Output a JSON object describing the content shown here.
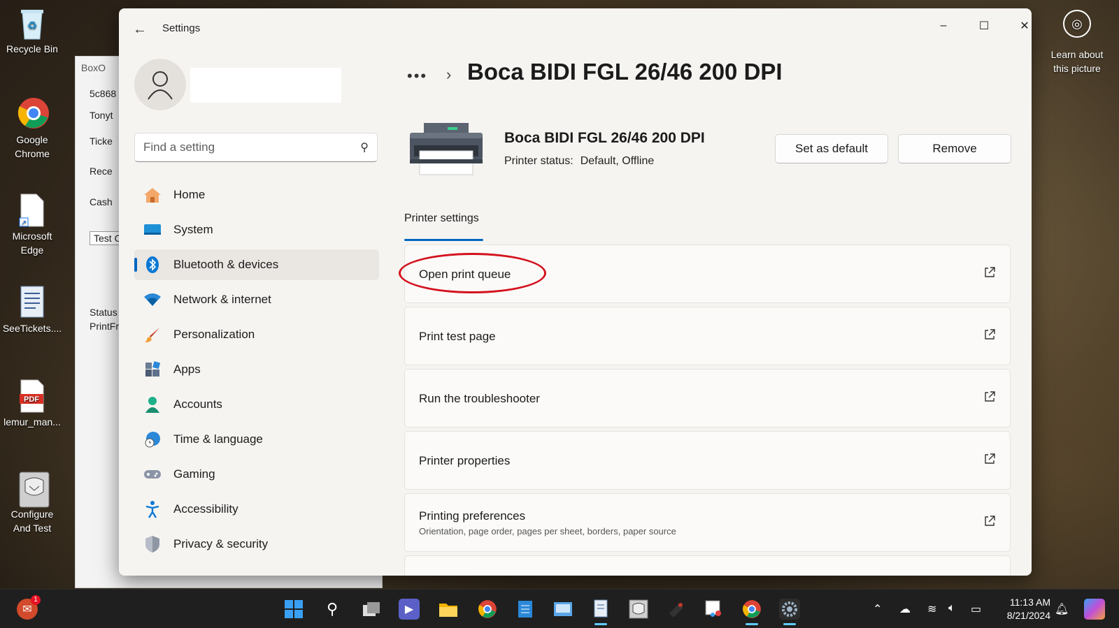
{
  "desktop": {
    "icons": [
      {
        "label": "Recycle Bin",
        "icon": "recycle-bin-icon"
      },
      {
        "label": "Google Chrome",
        "icon": "chrome-icon"
      },
      {
        "label": "Microsoft Edge",
        "icon": "edge-shortcut-icon"
      },
      {
        "label": "SeeTickets....",
        "icon": "document-icon"
      },
      {
        "label": "lemur_man...",
        "icon": "pdf-icon"
      },
      {
        "label": "Configure And Test",
        "icon": "configure-icon"
      }
    ],
    "learn": "Learn about this picture"
  },
  "background_window": {
    "title": "BoxO",
    "rows": [
      "5c868",
      "Tonyt",
      "Ticke",
      "Rece",
      "Cash",
      "Test C",
      "Status",
      "PrintFr"
    ]
  },
  "window": {
    "title": "Settings",
    "caption": {
      "minimize": "–",
      "maximize": "☐",
      "close": "✕"
    }
  },
  "sidebar": {
    "search_placeholder": "Find a setting",
    "items": [
      {
        "label": "Home",
        "icon": "home-icon",
        "active": false
      },
      {
        "label": "System",
        "icon": "system-icon",
        "active": false
      },
      {
        "label": "Bluetooth & devices",
        "icon": "bluetooth-icon",
        "active": true
      },
      {
        "label": "Network & internet",
        "icon": "wifi-icon",
        "active": false
      },
      {
        "label": "Personalization",
        "icon": "brush-icon",
        "active": false
      },
      {
        "label": "Apps",
        "icon": "apps-icon",
        "active": false
      },
      {
        "label": "Accounts",
        "icon": "accounts-icon",
        "active": false
      },
      {
        "label": "Time & language",
        "icon": "clock-globe-icon",
        "active": false
      },
      {
        "label": "Gaming",
        "icon": "gamepad-icon",
        "active": false
      },
      {
        "label": "Accessibility",
        "icon": "accessibility-icon",
        "active": false
      },
      {
        "label": "Privacy & security",
        "icon": "shield-icon",
        "active": false
      }
    ]
  },
  "main": {
    "breadcrumb_more": "•••",
    "breadcrumb_sep": "›",
    "title": "Boca BIDI FGL 26/46 200 DPI",
    "printer": {
      "name": "Boca BIDI FGL 26/46 200 DPI",
      "status_label": "Printer status:",
      "status_value": "Default, Offline"
    },
    "buttons": {
      "set_default": "Set as default",
      "remove": "Remove"
    },
    "tab": "Printer settings",
    "items": [
      {
        "label": "Open print queue",
        "sub": "",
        "highlighted": true
      },
      {
        "label": "Print test page",
        "sub": ""
      },
      {
        "label": "Run the troubleshooter",
        "sub": ""
      },
      {
        "label": "Printer properties",
        "sub": ""
      },
      {
        "label": "Printing preferences",
        "sub": "Orientation, page order, pages per sheet, borders, paper source"
      }
    ]
  },
  "taskbar": {
    "notification_badge": "1",
    "time": "11:13 AM",
    "date": "8/21/2024"
  },
  "colors": {
    "accent": "#0067c0",
    "highlight_ring": "#d4121e"
  }
}
